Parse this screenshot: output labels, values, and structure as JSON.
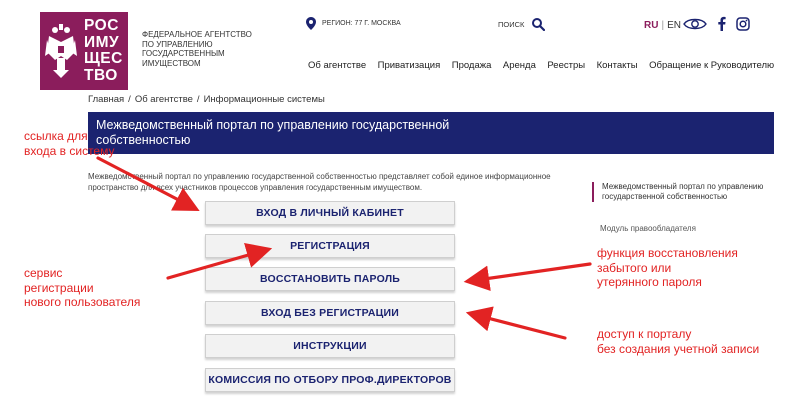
{
  "header": {
    "logo_lines": [
      "РОС",
      "ИМУ",
      "ЩЕС",
      "ТВО"
    ],
    "agency_name": "Федеральное агентство по управлению государственным имуществом",
    "region": "Регион: 77 г. Москва",
    "search_label": "Поиск",
    "lang_ru": "RU",
    "lang_sep": "|",
    "lang_en": "EN",
    "icons": [
      "eye-icon",
      "facebook-icon",
      "instagram-icon"
    ],
    "accent_color": "#8b1d5c"
  },
  "nav": {
    "items": [
      {
        "label": "Об агентстве"
      },
      {
        "label": "Приватизация"
      },
      {
        "label": "Продажа"
      },
      {
        "label": "Аренда"
      },
      {
        "label": "Реестры"
      },
      {
        "label": "Контакты"
      },
      {
        "label": "Обращение к Руководителю"
      }
    ]
  },
  "breadcrumb": {
    "items": [
      "Главная",
      "/",
      "Об агентстве",
      "/",
      "Информационные системы"
    ]
  },
  "page": {
    "title": "Межведомственный портал по управлению государственной собственностью",
    "intro": "Межведомственный портал по управлению государственной собственностью представляет собой единое информационное пространство для всех участников процессов управления государственным имуществом.",
    "banner_color": "#1b2370"
  },
  "buttons": [
    {
      "label": "Вход в личный кабинет"
    },
    {
      "label": "Регистрация"
    },
    {
      "label": "Восстановить пароль"
    },
    {
      "label": "Вход без регистрации"
    },
    {
      "label": "Инструкции"
    },
    {
      "label": "Комиссия по отбору проф.директоров"
    }
  ],
  "sidebar": {
    "active_item": "Межведомственный портал по управлению государственной собственностью",
    "item": "Модуль правообладателя"
  },
  "annotations": {
    "color": "#e22323",
    "login": [
      "ссылка для",
      "входа в систему"
    ],
    "registration": [
      "сервис",
      "регистрации",
      "нового пользователя"
    ],
    "restore": [
      "функция восстановления",
      "забытого или",
      "утерянного пароля"
    ],
    "noreg": [
      "доступ к порталу",
      "без создания учетной записи"
    ]
  }
}
